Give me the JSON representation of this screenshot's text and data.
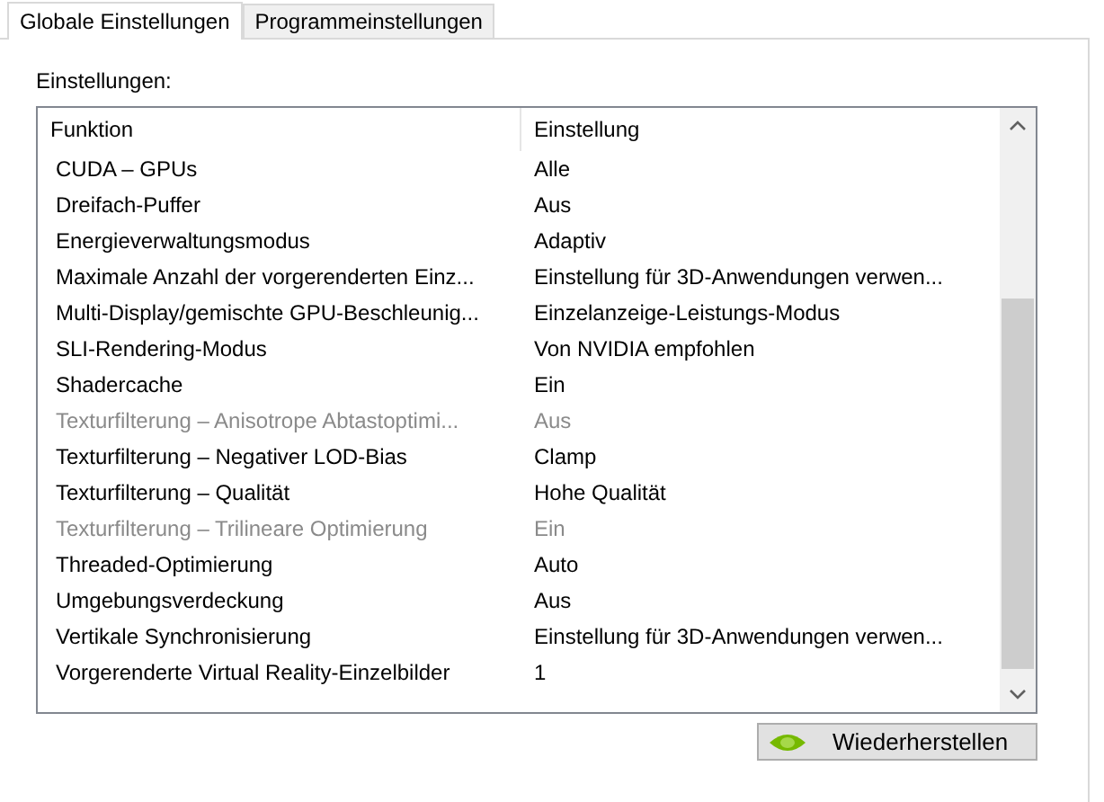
{
  "tabs": [
    {
      "label": "Globale Einstellungen",
      "selected": true
    },
    {
      "label": "Programmeinstellungen",
      "selected": false
    }
  ],
  "settings_label": "Einstellungen:",
  "table": {
    "columns": [
      "Funktion",
      "Einstellung"
    ],
    "rows": [
      {
        "function": "CUDA – GPUs",
        "setting": "Alle",
        "disabled": false
      },
      {
        "function": "Dreifach-Puffer",
        "setting": "Aus",
        "disabled": false
      },
      {
        "function": "Energieverwaltungsmodus",
        "setting": "Adaptiv",
        "disabled": false
      },
      {
        "function": "Maximale Anzahl der vorgerenderten Einz...",
        "setting": "Einstellung für 3D-Anwendungen verwen...",
        "disabled": false
      },
      {
        "function": "Multi-Display/gemischte GPU-Beschleunig...",
        "setting": "Einzelanzeige-Leistungs-Modus",
        "disabled": false
      },
      {
        "function": "SLI-Rendering-Modus",
        "setting": "Von NVIDIA empfohlen",
        "disabled": false
      },
      {
        "function": "Shadercache",
        "setting": "Ein",
        "disabled": false
      },
      {
        "function": "Texturfilterung – Anisotrope Abtastoptimi...",
        "setting": "Aus",
        "disabled": true
      },
      {
        "function": "Texturfilterung – Negativer LOD-Bias",
        "setting": "Clamp",
        "disabled": false
      },
      {
        "function": "Texturfilterung – Qualität",
        "setting": "Hohe Qualität",
        "disabled": false
      },
      {
        "function": "Texturfilterung – Trilineare Optimierung",
        "setting": "Ein",
        "disabled": true
      },
      {
        "function": "Threaded-Optimierung",
        "setting": "Auto",
        "disabled": false
      },
      {
        "function": "Umgebungsverdeckung",
        "setting": "Aus",
        "disabled": false
      },
      {
        "function": "Vertikale Synchronisierung",
        "setting": "Einstellung für 3D-Anwendungen verwen...",
        "disabled": false
      },
      {
        "function": "Vorgerenderte Virtual Reality-Einzelbilder",
        "setting": "1",
        "disabled": false
      }
    ]
  },
  "restore_button": "Wiederherstellen"
}
